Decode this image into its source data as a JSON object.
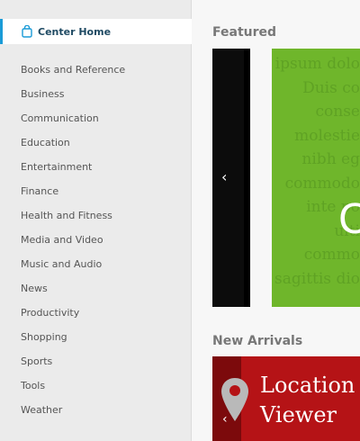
{
  "sidebar": {
    "home": {
      "label": "Center Home",
      "icon": "bag-icon"
    },
    "categories": [
      "Books and Reference",
      "Business",
      "Communication",
      "Education",
      "Entertainment",
      "Finance",
      "Health and Fitness",
      "Media and Video",
      "Music and Audio",
      "News",
      "Productivity",
      "Shopping",
      "Sports",
      "Tools",
      "Weather"
    ],
    "accent_color": "#1a9bd7"
  },
  "featured": {
    "title": "Featured",
    "prev_arrow": "‹",
    "banner_text": [
      "ipsum dolo",
      "Duis co",
      "conse",
      "molestie",
      "nibh eg",
      "commodo",
      "inte po",
      "ulti",
      "commo",
      "sagittis dio"
    ],
    "banner_letter": "C",
    "banner_color": "#6fb62b"
  },
  "new_arrivals": {
    "title": "New Arrivals",
    "prev_arrow": "‹",
    "app_title_line1": "Location",
    "app_title_line2": "Viewer",
    "card_color": "#b51316",
    "icon": "map-pin-icon"
  }
}
